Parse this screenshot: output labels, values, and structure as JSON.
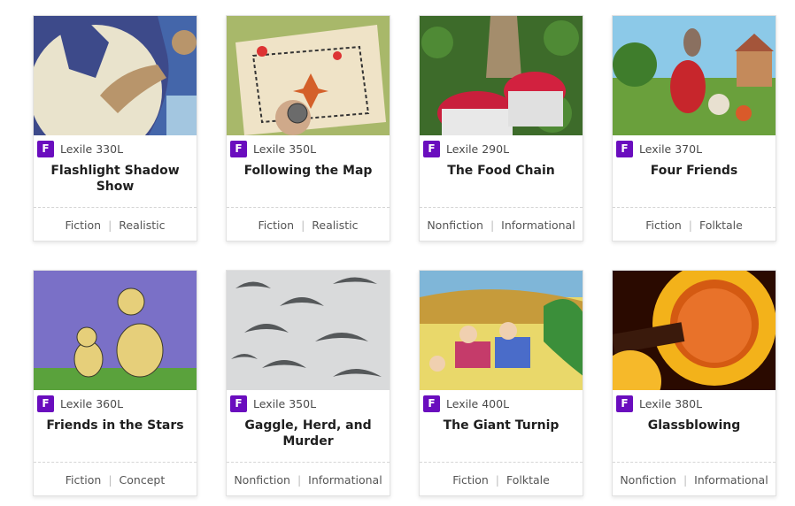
{
  "colors": {
    "badge": "#6a0dbe",
    "tag_text": "#555555",
    "separator": "#bdbdbd"
  },
  "badge_letter": "F",
  "books": [
    {
      "title": "Flashlight Shadow Show",
      "lexile": "Lexile 330L",
      "genre": "Fiction",
      "subgenre": "Realistic",
      "cover": "shadow-puppet-image"
    },
    {
      "title": "Following the Map",
      "lexile": "Lexile 350L",
      "genre": "Fiction",
      "subgenre": "Realistic",
      "cover": "treasure-map-image"
    },
    {
      "title": "The Food Chain",
      "lexile": "Lexile 290L",
      "genre": "Nonfiction",
      "subgenre": "Informational",
      "cover": "strawberry-field-image"
    },
    {
      "title": "Four Friends",
      "lexile": "Lexile 370L",
      "genre": "Fiction",
      "subgenre": "Folktale",
      "cover": "animal-friends-image"
    },
    {
      "title": "Friends in the Stars",
      "lexile": "Lexile 360L",
      "genre": "Fiction",
      "subgenre": "Concept",
      "cover": "dogs-night-sky-image"
    },
    {
      "title": "Gaggle, Herd, and Murder",
      "lexile": "Lexile 350L",
      "genre": "Nonfiction",
      "subgenre": "Informational",
      "cover": "flock-of-birds-image"
    },
    {
      "title": "The Giant Turnip",
      "lexile": "Lexile 400L",
      "genre": "Fiction",
      "subgenre": "Folktale",
      "cover": "turnip-harvest-image"
    },
    {
      "title": "Glassblowing",
      "lexile": "Lexile 380L",
      "genre": "Nonfiction",
      "subgenre": "Informational",
      "cover": "molten-glass-image"
    }
  ]
}
